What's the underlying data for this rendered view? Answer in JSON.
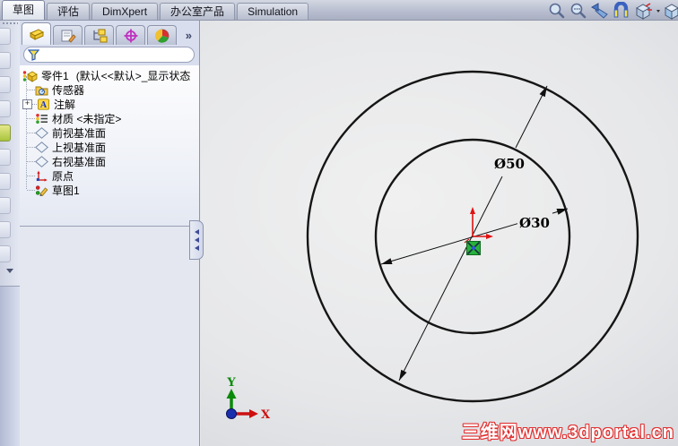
{
  "ribbon": {
    "tabs": [
      {
        "label": "草图",
        "active": true
      },
      {
        "label": "评估",
        "active": false
      },
      {
        "label": "DimXpert",
        "active": false
      },
      {
        "label": "办公室产品",
        "active": false
      },
      {
        "label": "Simulation",
        "active": false
      }
    ]
  },
  "view_toolbar": {
    "icons": [
      {
        "name": "zoom-to-fit"
      },
      {
        "name": "zoom-to-area"
      },
      {
        "name": "previous-view"
      },
      {
        "name": "section-view"
      },
      {
        "name": "view-orientation",
        "has_dropdown": true
      },
      {
        "name": "display-style"
      }
    ]
  },
  "panel": {
    "manager_tabs": [
      {
        "name": "featuremanager-design-tree",
        "active": true
      },
      {
        "name": "propertymanager",
        "active": false
      },
      {
        "name": "configurationmanager",
        "active": false
      },
      {
        "name": "dimxpertmanager",
        "active": false
      },
      {
        "name": "displaymanager",
        "active": false
      }
    ],
    "overflow_label": "»",
    "filter": {
      "placeholder": ""
    },
    "tree": {
      "root_label": "零件1",
      "root_suffix": "(默认<<默认>_显示状态",
      "items": [
        {
          "label": "传感器"
        },
        {
          "label": "注解",
          "expand_glyph": "+"
        },
        {
          "label": "材质 <未指定>"
        },
        {
          "label": "前视基准面"
        },
        {
          "label": "上视基准面"
        },
        {
          "label": "右视基准面"
        },
        {
          "label": "原点"
        },
        {
          "label": "草图1"
        }
      ]
    }
  },
  "viewport": {
    "sketch": {
      "outer_circle_dimension": "Ø50",
      "inner_circle_dimension": "Ø30"
    },
    "dim_outer": "Ø50",
    "dim_inner": "Ø30",
    "triad": {
      "x_label": "X",
      "y_label": "Y"
    },
    "watermark": "三维网www.3dportal.cn"
  },
  "colors": {
    "circle_stroke": "#151515",
    "dimension_text": "#000000",
    "origin_red": "#e01212",
    "sketch_point_green": "#28b03c",
    "triad_x_red": "#cc1111",
    "triad_y_green": "#0a8a0a",
    "triad_z_blue": "#1a2fae",
    "watermark_red": "#e23030",
    "panel_chrome": "#d8deee"
  }
}
